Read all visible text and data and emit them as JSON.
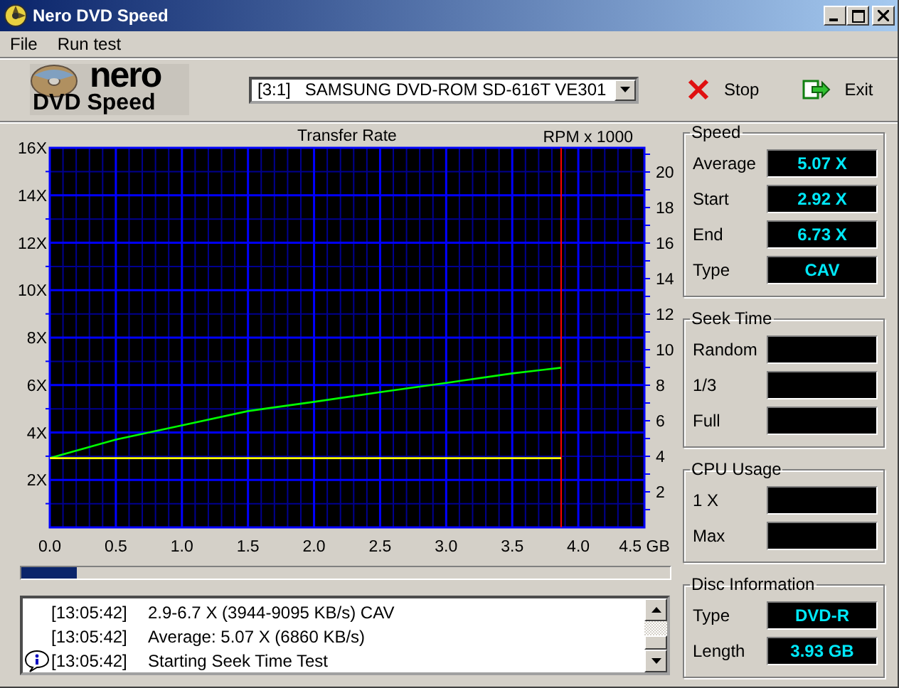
{
  "window": {
    "title": "Nero DVD Speed"
  },
  "menu": [
    {
      "label": "File"
    },
    {
      "label": "Run test"
    }
  ],
  "logo": {
    "line_1": "nero",
    "line_2": "DVD Speed"
  },
  "drive_select": {
    "value": "[3:1]   SAMSUNG DVD-ROM SD-616T VE301"
  },
  "toolbar_buttons": [
    {
      "label": "Stop",
      "kind": "stop"
    },
    {
      "label": "Exit",
      "kind": "exit"
    }
  ],
  "chart": {
    "chart_data": {
      "type": "line",
      "title": "Transfer Rate",
      "y2label": "RPM x 1000",
      "grid": true,
      "xlim": [
        0,
        4.5
      ],
      "ylim": [
        0,
        16
      ],
      "y2lim": [
        0,
        21.36
      ],
      "x": [
        0,
        0.5,
        1.0,
        1.5,
        2.0,
        2.5,
        3.0,
        3.5,
        3.87
      ],
      "series": [
        {
          "color": "#00ff00",
          "values": [
            2.92,
            3.7,
            4.3,
            4.9,
            5.29,
            5.7,
            6.09,
            6.49,
            6.73
          ]
        },
        {
          "color": "#ffff00",
          "axis": "y2",
          "values": [
            3.9,
            3.9,
            3.9,
            3.9,
            3.9,
            3.9,
            3.9,
            3.9,
            3.9
          ]
        }
      ],
      "xticks": [
        {
          "value": 0,
          "label": "0.0"
        },
        {
          "value": 0.5,
          "label": "0.5"
        },
        {
          "value": 1,
          "label": "1.0"
        },
        {
          "value": 1.5,
          "label": "1.5"
        },
        {
          "value": 2,
          "label": "2.0"
        },
        {
          "value": 2.5,
          "label": "2.5"
        },
        {
          "value": 3,
          "label": "3.0"
        },
        {
          "value": 3.5,
          "label": "3.5"
        },
        {
          "value": 4,
          "label": "4.0"
        },
        {
          "value": 4.5,
          "label": "4.5 GB"
        }
      ],
      "yticks": [
        {
          "value": 2,
          "label": "2X"
        },
        {
          "value": 4,
          "label": "4X"
        },
        {
          "value": 6,
          "label": "6X"
        },
        {
          "value": 8,
          "label": "8X"
        },
        {
          "value": 10,
          "label": "10X"
        },
        {
          "value": 12,
          "label": "12X"
        },
        {
          "value": 14,
          "label": "14X"
        },
        {
          "value": 16,
          "label": "16X"
        }
      ],
      "y2ticks": [
        {
          "value": 2,
          "label": "2"
        },
        {
          "value": 4,
          "label": "4"
        },
        {
          "value": 6,
          "label": "6"
        },
        {
          "value": 8,
          "label": "8"
        },
        {
          "value": 10,
          "label": "10"
        },
        {
          "value": 12,
          "label": "12"
        },
        {
          "value": 14,
          "label": "14"
        },
        {
          "value": 16,
          "label": "16"
        },
        {
          "value": 18,
          "label": "18"
        },
        {
          "value": 20,
          "label": "20"
        }
      ],
      "ref_lines": [
        {
          "axis": "x",
          "value": 3.87,
          "color": "#ff0000"
        }
      ]
    }
  },
  "progress": {
    "level": 0.085
  },
  "log": [
    {
      "time": "[13:05:42]",
      "message": "2.9-6.7 X (3944-9095 KB/s) CAV",
      "kind": "plain"
    },
    {
      "time": "[13:05:42]",
      "message": "Average: 5.07 X (6860 KB/s)",
      "kind": "plain"
    },
    {
      "time": "[13:05:42]",
      "message": "Starting Seek Time Test",
      "kind": "info"
    }
  ],
  "groups": [
    {
      "title": "Speed",
      "fields": [
        {
          "label": "Average",
          "value": "5.07 X"
        },
        {
          "label": "Start",
          "value": "2.92 X"
        },
        {
          "label": "End",
          "value": "6.73 X"
        },
        {
          "label": "Type",
          "value": "CAV"
        }
      ]
    },
    {
      "title": "Seek Time",
      "fields": [
        {
          "label": "Random"
        },
        {
          "label": "1/3"
        },
        {
          "label": "Full"
        }
      ]
    },
    {
      "title": "CPU Usage",
      "fields": [
        {
          "label": "1 X"
        },
        {
          "label": "Max"
        }
      ]
    },
    {
      "title": "Disc Information",
      "fields": [
        {
          "label": "Type",
          "value": "DVD-R"
        },
        {
          "label": "Length",
          "value": "3.93 GB"
        }
      ]
    }
  ]
}
